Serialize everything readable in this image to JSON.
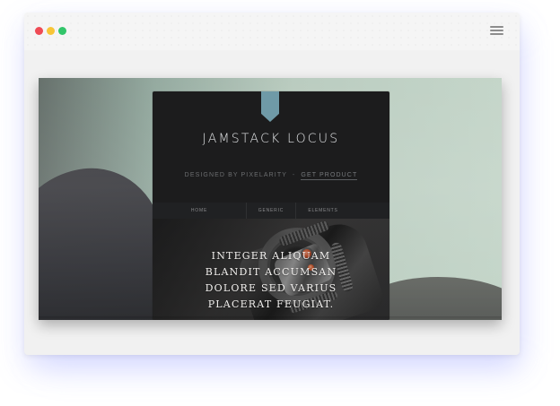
{
  "window": {
    "menu_icon": "menu-icon",
    "dots": [
      "red-dot",
      "yellow-dot",
      "green-dot"
    ]
  },
  "site": {
    "title": "JAMSTACK LOCUS",
    "subtitle_prefix": "DESIGNED BY PIXELARITY",
    "subtitle_separator": "-",
    "subtitle_link": "GET PRODUCT",
    "nav": [
      "HOME",
      "GENERIC",
      "ELEMENTS"
    ],
    "hero_lines": [
      "INTEGER ALIQUAM",
      "BLANDIT ACCUMSAN",
      "DOLORE SED VARIUS",
      "PLACERAT FEUGIAT."
    ]
  },
  "colors": {
    "accent": "#6f9aa7",
    "window_background": "#f1f1f1",
    "panel_background": "#1c1c1d",
    "red": "#ef4b55",
    "yellow": "#f8c537",
    "green": "#32c56a"
  }
}
